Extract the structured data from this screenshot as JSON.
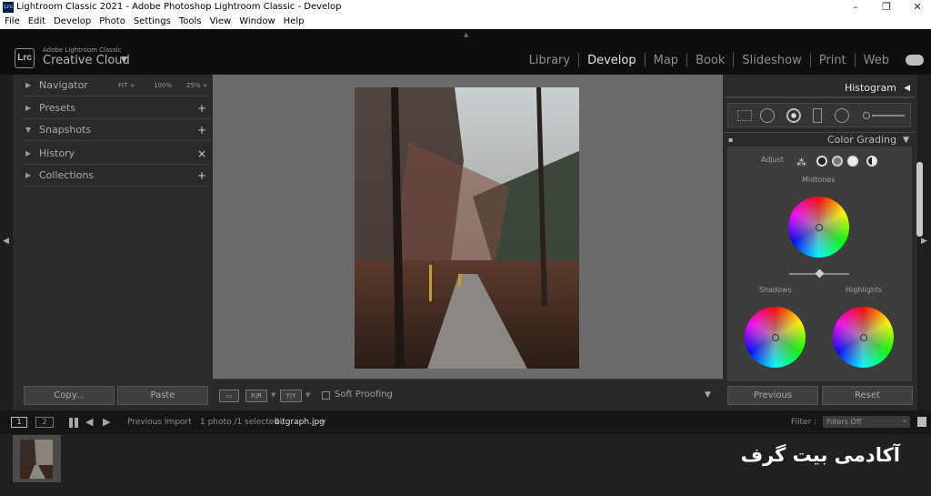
{
  "window": {
    "title": "Lightroom Classic 2021 - Adobe Photoshop Lightroom Classic - Develop",
    "app_icon": "Lrc"
  },
  "menu": [
    "File",
    "Edit",
    "Develop",
    "Photo",
    "Settings",
    "Tools",
    "View",
    "Window",
    "Help"
  ],
  "identity": {
    "logo": "Lrc",
    "small": "Adobe Lightroom Classic",
    "name": "Creative Cloud"
  },
  "modules": [
    "Library",
    "Develop",
    "Map",
    "Book",
    "Slideshow",
    "Print",
    "Web"
  ],
  "active_module": "Develop",
  "left_panel": {
    "sections": [
      {
        "label": "Navigator",
        "state": "collapsed"
      },
      {
        "label": "Presets",
        "action": "+"
      },
      {
        "label": "Snapshots",
        "state": "expanded",
        "action": "+"
      },
      {
        "label": "History",
        "action": "×"
      },
      {
        "label": "Collections",
        "action": "+"
      }
    ],
    "navigator_options": [
      "FIT ÷",
      "100%",
      "25% ÷"
    ],
    "copy_label": "Copy...",
    "paste_label": "Paste"
  },
  "toolbar": {
    "soft_proofing": "Soft Proofing"
  },
  "right_panel": {
    "histogram": "Histogram",
    "color_grading": "Color Grading",
    "adjust": "Adjust",
    "midtones": "Midtones",
    "shadows": "Shadows",
    "highlights": "Highlights",
    "previous_label": "Previous",
    "reset_label": "Reset"
  },
  "filmstrip": {
    "page1": "1",
    "page2": "2",
    "source": "Previous Import",
    "count": "1 photo /1 selected /",
    "filename": "bitgraph.jpg",
    "filter_label": "Filter :",
    "filter_value": "Filters Off"
  },
  "watermark": "آکادمی بیت گرف",
  "colors": {
    "accent": "#e5e5e5",
    "panel_bg": "#2a2a2a",
    "workspace_bg": "#6b6b6b"
  }
}
